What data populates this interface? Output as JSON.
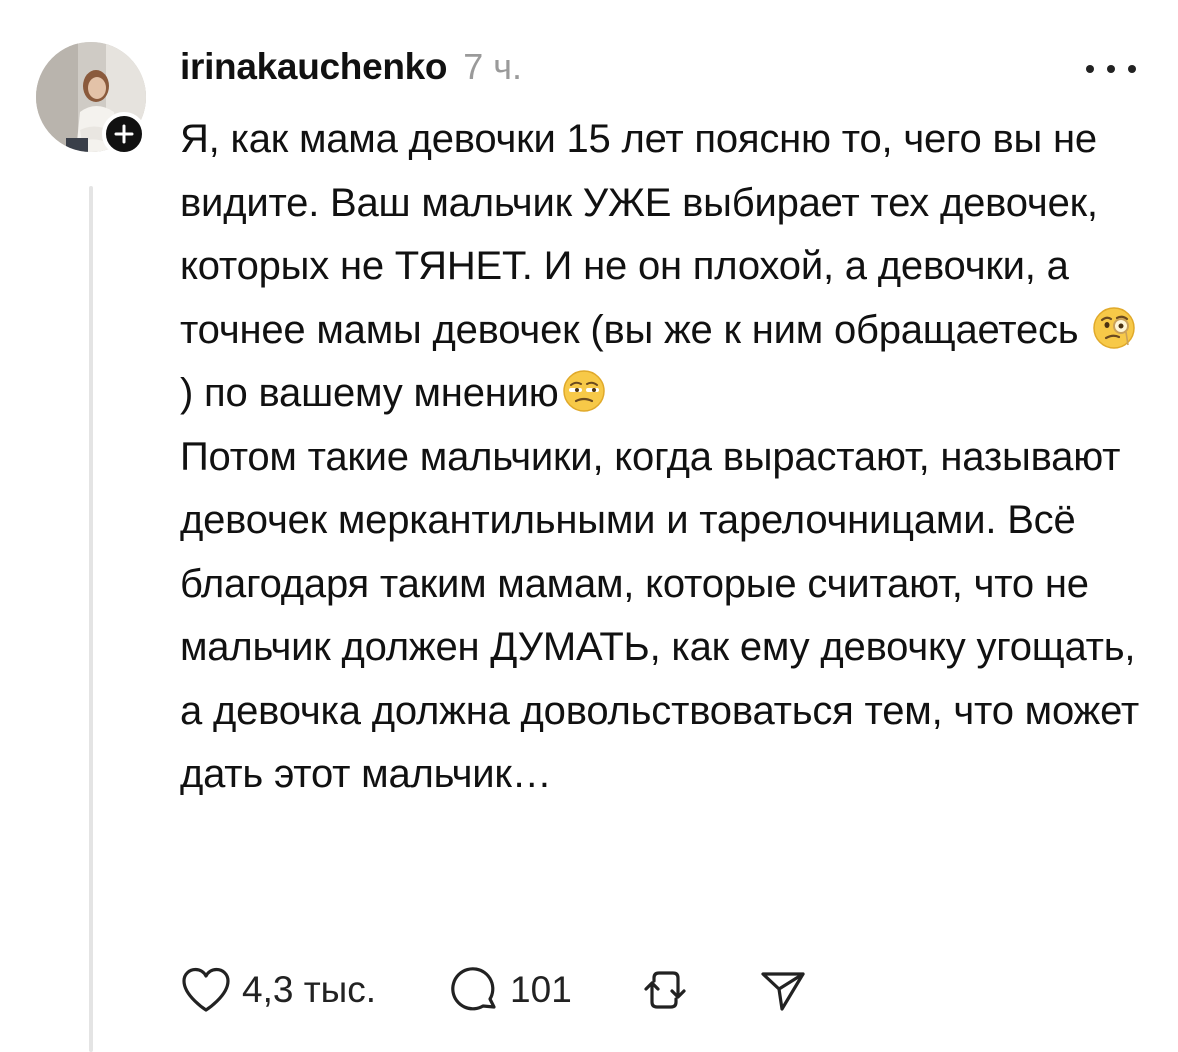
{
  "post": {
    "username": "irinakauchenko",
    "time": "7 ч.",
    "paragraphs": [
      {
        "a": "Я, как мама девочки 15 лет поясню то, чего вы не видите. Ваш мальчик УЖЕ выбирает тех девочек, которых не ТЯНЕТ. И не он плохой, а девочки, а точнее мамы девочек (вы же к ним обращаетесь ",
        "b": ") по вашему мнению"
      },
      {
        "a": "Потом такие мальчики, когда вырастают, называют девочек меркантильными и тарелочницами. Всё благодаря таким мамам, которые считают, что не мальчик должен ДУМАТЬ, как ему девочку угощать, а девочка должна довольствоваться тем, что может дать этот мальчик…"
      }
    ],
    "emojis": [
      "face-with-monocle-icon",
      "unamused-face-icon"
    ]
  },
  "actions": {
    "likes": "4,3 тыс.",
    "replies": "101"
  },
  "colors": {
    "text": "#111111",
    "muted": "#9a9a9a",
    "thread_line": "#e4e4e4"
  }
}
